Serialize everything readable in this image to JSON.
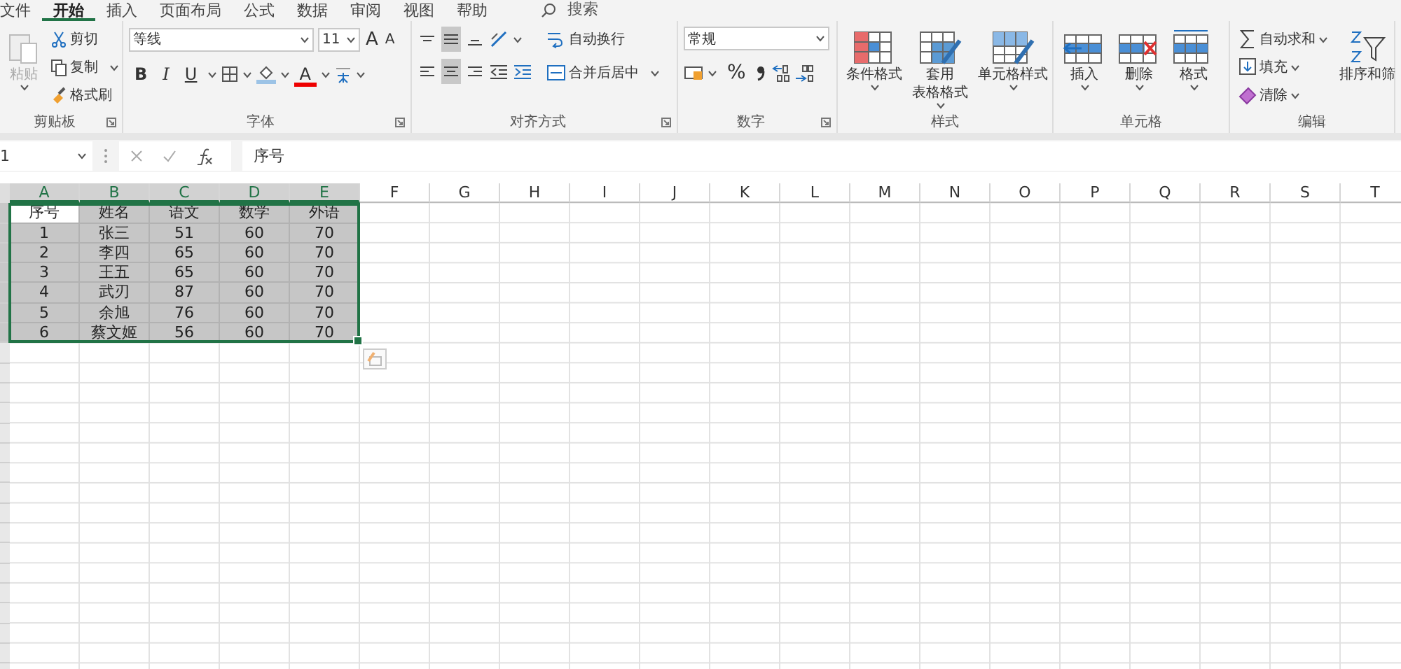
{
  "menu_tabs": [
    {
      "label": "文件",
      "selected": false
    },
    {
      "label": "开始",
      "selected": true
    },
    {
      "label": "插入",
      "selected": false
    },
    {
      "label": "页面布局",
      "selected": false
    },
    {
      "label": "公式",
      "selected": false
    },
    {
      "label": "数据",
      "selected": false
    },
    {
      "label": "审阅",
      "selected": false
    },
    {
      "label": "视图",
      "selected": false
    },
    {
      "label": "帮助",
      "selected": false
    }
  ],
  "search": {
    "label": "搜索"
  },
  "ribbon": [
    {
      "kind": "clipboard",
      "name": "剪贴板",
      "paste": {
        "label": "粘贴",
        "disabled": true
      },
      "commands": [
        {
          "label": "剪切",
          "caret": false
        },
        {
          "label": "复制",
          "caret": true
        },
        {
          "label": "格式刷",
          "caret": false
        }
      ]
    },
    {
      "kind": "font",
      "name": "字体",
      "font": "等线",
      "size": "11",
      "grow": "A",
      "shrink": "A",
      "styles": [
        "B",
        "I",
        "U"
      ],
      "font_color": "A"
    },
    {
      "kind": "alignment",
      "name": "对齐方式",
      "align_buttons": [
        {
          "selected": false
        },
        {
          "selected": true
        },
        {
          "selected": false
        },
        {
          "selected": false
        },
        {
          "selected": true
        },
        {
          "selected": false
        }
      ],
      "commands": [
        "自动换行",
        "合并后居中"
      ]
    },
    {
      "kind": "number",
      "name": "数字",
      "format": "常规",
      "percent": "%"
    },
    {
      "kind": "large",
      "name": "样式",
      "buttons": [
        {
          "label_lines": [
            "条件格式"
          ]
        },
        {
          "label_lines": [
            "套用",
            "表格格式"
          ]
        },
        {
          "label_lines": [
            "单元格样式"
          ]
        }
      ]
    },
    {
      "kind": "large",
      "name": "单元格",
      "buttons": [
        {
          "label_lines": [
            "插入"
          ]
        },
        {
          "label_lines": [
            "删除"
          ]
        },
        {
          "label_lines": [
            "格式"
          ]
        }
      ]
    },
    {
      "kind": "editing",
      "name": "编辑",
      "commands": [
        {
          "label": "自动求和",
          "caret": true
        },
        {
          "label": "填充",
          "caret": true
        },
        {
          "label": "清除",
          "caret": true
        }
      ],
      "sort": "排序和筛"
    }
  ],
  "formula_bar": {
    "name_box": "1",
    "value": "序号"
  },
  "sheet": {
    "columns": [
      {
        "label": "A",
        "selected": true
      },
      {
        "label": "B",
        "selected": true
      },
      {
        "label": "C",
        "selected": true
      },
      {
        "label": "D",
        "selected": true
      },
      {
        "label": "E",
        "selected": true
      },
      {
        "label": "F",
        "selected": false
      },
      {
        "label": "G",
        "selected": false
      },
      {
        "label": "H",
        "selected": false
      },
      {
        "label": "I",
        "selected": false
      },
      {
        "label": "J",
        "selected": false
      },
      {
        "label": "K",
        "selected": false
      },
      {
        "label": "L",
        "selected": false
      },
      {
        "label": "M",
        "selected": false
      },
      {
        "label": "N",
        "selected": false
      },
      {
        "label": "O",
        "selected": false
      },
      {
        "label": "P",
        "selected": false
      },
      {
        "label": "Q",
        "selected": false
      },
      {
        "label": "R",
        "selected": false
      },
      {
        "label": "S",
        "selected": false
      },
      {
        "label": "T",
        "selected": false
      }
    ],
    "rows": [
      {
        "selected": true,
        "cells": [
          {
            "text": "序号",
            "active": true
          },
          {
            "text": "姓名",
            "active": false
          },
          {
            "text": "语文",
            "active": false
          },
          {
            "text": "数学",
            "active": false
          },
          {
            "text": "外语",
            "active": false
          }
        ]
      },
      {
        "selected": true,
        "cells": [
          {
            "text": "1",
            "active": false
          },
          {
            "text": "张三",
            "active": false
          },
          {
            "text": "51",
            "active": false
          },
          {
            "text": "60",
            "active": false
          },
          {
            "text": "70",
            "active": false
          }
        ]
      },
      {
        "selected": true,
        "cells": [
          {
            "text": "2",
            "active": false
          },
          {
            "text": "李四",
            "active": false
          },
          {
            "text": "65",
            "active": false
          },
          {
            "text": "60",
            "active": false
          },
          {
            "text": "70",
            "active": false
          }
        ]
      },
      {
        "selected": true,
        "cells": [
          {
            "text": "3",
            "active": false
          },
          {
            "text": "王五",
            "active": false
          },
          {
            "text": "65",
            "active": false
          },
          {
            "text": "60",
            "active": false
          },
          {
            "text": "70",
            "active": false
          }
        ]
      },
      {
        "selected": true,
        "cells": [
          {
            "text": "4",
            "active": false
          },
          {
            "text": "武刃",
            "active": false
          },
          {
            "text": "87",
            "active": false
          },
          {
            "text": "60",
            "active": false
          },
          {
            "text": "70",
            "active": false
          }
        ]
      },
      {
        "selected": true,
        "cells": [
          {
            "text": "5",
            "active": false
          },
          {
            "text": "余旭",
            "active": false
          },
          {
            "text": "76",
            "active": false
          },
          {
            "text": "60",
            "active": false
          },
          {
            "text": "70",
            "active": false
          }
        ]
      },
      {
        "selected": true,
        "cells": [
          {
            "text": "6",
            "active": false
          },
          {
            "text": "蔡文姬",
            "active": false
          },
          {
            "text": "56",
            "active": false
          },
          {
            "text": "60",
            "active": false
          },
          {
            "text": "70",
            "active": false
          }
        ]
      }
    ]
  }
}
